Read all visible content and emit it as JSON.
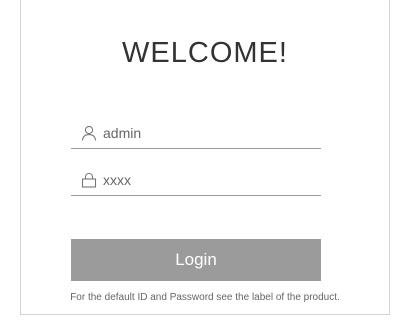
{
  "login": {
    "title": "WELCOME!",
    "username": {
      "value": "admin",
      "icon": "user-icon"
    },
    "password": {
      "value": "xxxx",
      "icon": "lock-icon"
    },
    "login_label": "Login",
    "hint": "For the default ID and Password see the label of the product."
  },
  "colors": {
    "button_bg": "#9b9b9b",
    "button_text": "#ffffff",
    "border": "#d4d4d4",
    "title_text": "#333333"
  }
}
